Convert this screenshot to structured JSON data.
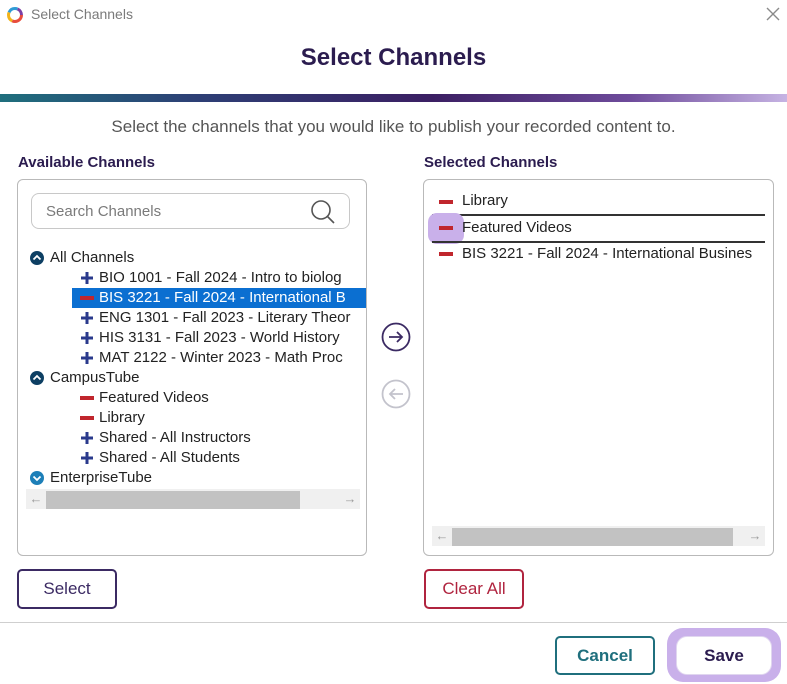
{
  "window": {
    "title": "Select Channels",
    "close_symbol": "×"
  },
  "dialog": {
    "heading": "Select Channels",
    "instructions": "Select the channels that you would like to publish your recorded content to."
  },
  "available": {
    "label": "Available Channels",
    "search_placeholder": "Search Channels",
    "groups": [
      {
        "name": "All Channels",
        "expanded": true,
        "items": [
          {
            "label": "BIO 1001 - Fall 2024 - Intro to biolog",
            "icon": "plus-icon",
            "selected": false
          },
          {
            "label": "BIS 3221 - Fall 2024 - International B",
            "icon": "minus-icon",
            "selected": true
          },
          {
            "label": "ENG 1301 - Fall 2023 - Literary Theor",
            "icon": "plus-icon",
            "selected": false
          },
          {
            "label": "HIS 3131 - Fall 2023 - World History",
            "icon": "plus-icon",
            "selected": false
          },
          {
            "label": "MAT 2122 - Winter 2023 - Math Proc",
            "icon": "plus-icon",
            "selected": false
          }
        ]
      },
      {
        "name": "CampusTube",
        "expanded": true,
        "items": [
          {
            "label": "Featured Videos",
            "icon": "minus-icon",
            "selected": false
          },
          {
            "label": "Library",
            "icon": "minus-icon",
            "selected": false
          },
          {
            "label": "Shared - All Instructors",
            "icon": "plus-icon",
            "selected": false
          },
          {
            "label": "Shared - All Students",
            "icon": "plus-icon",
            "selected": false
          }
        ]
      },
      {
        "name": "EnterpriseTube",
        "expanded": false,
        "items": []
      }
    ],
    "select_button": "Select"
  },
  "selected": {
    "label": "Selected Channels",
    "items": [
      {
        "label": "Library"
      },
      {
        "label": "Featured Videos"
      },
      {
        "label": "BIS 3221 - Fall 2024 - International Busines"
      }
    ],
    "clear_button": "Clear All"
  },
  "footer": {
    "cancel": "Cancel",
    "save": "Save"
  },
  "colors": {
    "heading": "#2b1c4f",
    "selection": "#0b6fd1",
    "add": "#2a3a8c",
    "remove": "#c0262d",
    "cancel_border": "#1f6f7d",
    "clear_border": "#b0243f",
    "highlight": "#c9b0ea"
  }
}
